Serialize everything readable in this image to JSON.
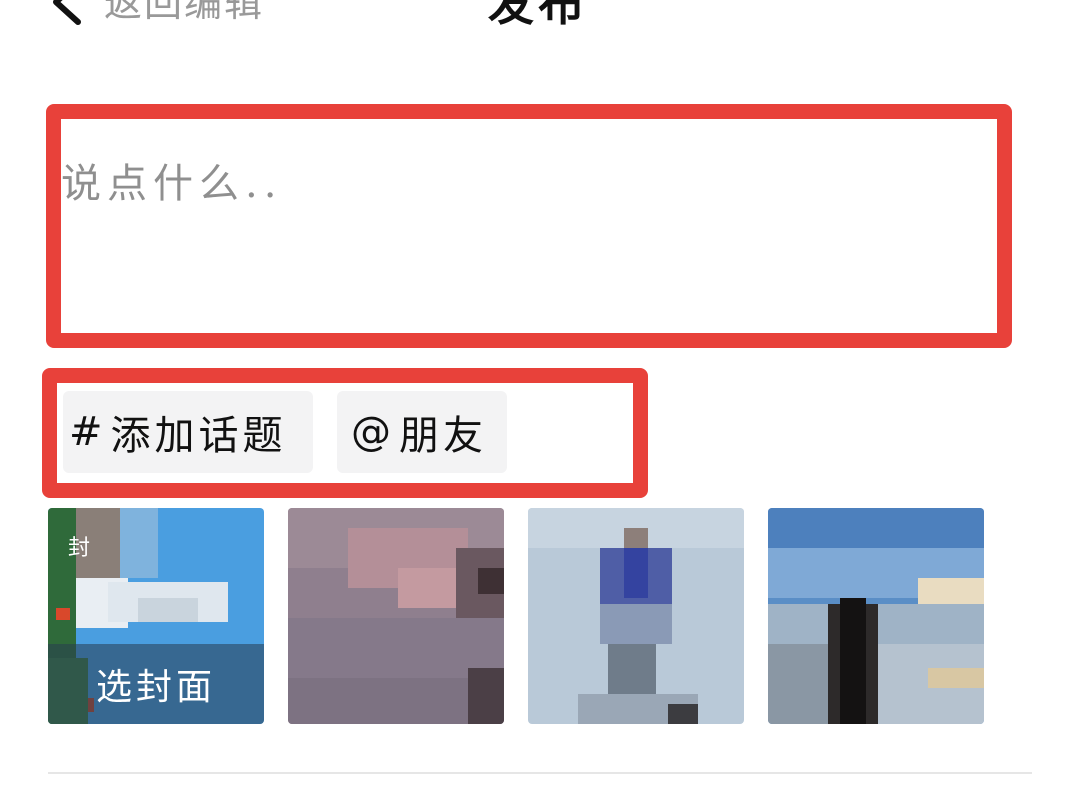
{
  "header": {
    "back_label": "返回编辑",
    "title": "发布"
  },
  "post_input": {
    "placeholder": "说点什么.."
  },
  "chips": {
    "topic_symbol": "#",
    "topic_label": "添加话题",
    "friend_symbol": "@",
    "friend_label": "朋友"
  },
  "media": {
    "cover_tag": "封",
    "cover_label": "选封面",
    "thumbnail_count": 4
  },
  "colors": {
    "highlight": "#e8413a",
    "chip_bg": "#f3f3f4",
    "placeholder": "#8f8f8f"
  }
}
